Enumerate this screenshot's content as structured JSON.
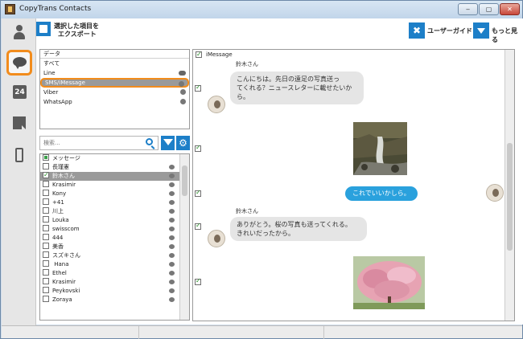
{
  "window": {
    "title": "CopyTrans Contacts",
    "buttons": {
      "minimize": "‒",
      "maximize": "▢",
      "close": "✕"
    }
  },
  "sidebar": {
    "items": [
      {
        "icon": "person-icon"
      },
      {
        "icon": "message-bubble-icon",
        "active": true
      },
      {
        "icon": "calendar-icon",
        "label": "24"
      },
      {
        "icon": "note-icon"
      },
      {
        "icon": "phone-icon"
      }
    ]
  },
  "toolbar": {
    "export_line1": "選択した項目を",
    "export_line2": "エクスポート",
    "guide_label": "ユーザーガイド",
    "more_label": "もっと見る"
  },
  "data_list": {
    "header": "データ",
    "items": [
      {
        "label": "すべて"
      },
      {
        "label": "Line"
      },
      {
        "label": "SMS/iMessage",
        "selected": true
      },
      {
        "label": "Viber"
      },
      {
        "label": "WhatsApp"
      }
    ]
  },
  "search": {
    "placeholder": "検索..."
  },
  "contacts": {
    "header": "メッセージ",
    "items": [
      {
        "name": "長瑾憲",
        "checked": false
      },
      {
        "name": "鈴木さん",
        "checked": true,
        "selected": true
      },
      {
        "name": "Krasimir",
        "checked": false
      },
      {
        "name": "Kony",
        "checked": false
      },
      {
        "name": "+41",
        "checked": false
      },
      {
        "name": "川上",
        "checked": false
      },
      {
        "name": "Louka",
        "checked": false
      },
      {
        "name": "swisscom",
        "checked": false
      },
      {
        "name": "444",
        "checked": false
      },
      {
        "name": "美香",
        "checked": false
      },
      {
        "name": "スズキさん",
        "checked": false
      },
      {
        "name": " Hana",
        "checked": false
      },
      {
        "name": "Ethel",
        "checked": false
      },
      {
        "name": "Krasimir",
        "checked": false
      },
      {
        "name": "Peykovski",
        "checked": false
      },
      {
        "name": "Zoraya",
        "checked": false
      }
    ]
  },
  "conversation": {
    "header": "iMessage",
    "messages": [
      {
        "sender": "鈴木さん",
        "text_lines": [
          "こんにちは。先日の遠足の写真送っ",
          "てくれる？ニュースレターに載せたいか",
          "ら。"
        ]
      },
      {
        "photo": "waterfall-photo"
      },
      {
        "text": "これでいいかしら。",
        "outgoing": true
      },
      {
        "sender": "鈴木さん",
        "text_lines": [
          "ありがとう。桜の写真も送ってくれる。",
          "きれいだったから。"
        ]
      },
      {
        "photo": "cherry-blossom-photo"
      }
    ]
  },
  "colors": {
    "accent_blue": "#1d7fc8",
    "highlight_orange": "#f28c1c",
    "bubble_out": "#2aa1dd",
    "bubble_in": "#e5e5e5"
  }
}
